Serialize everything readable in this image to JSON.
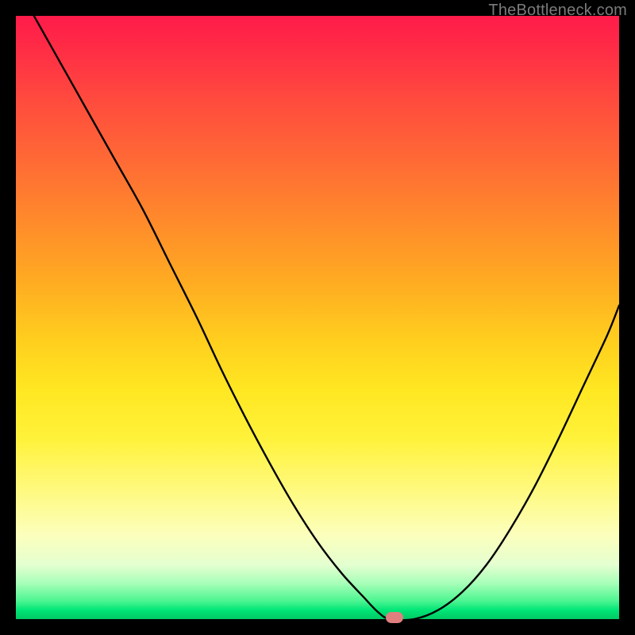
{
  "watermark": "TheBottleneck.com",
  "marker": {
    "x_frac": 0.628,
    "y_frac": 0.997
  },
  "colors": {
    "curve": "#000000",
    "marker": "#e17f7f",
    "frame": "#000000"
  },
  "chart_data": {
    "type": "line",
    "title": "",
    "xlabel": "",
    "ylabel": "",
    "xlim": [
      0,
      1
    ],
    "ylim": [
      0,
      1
    ],
    "annotations": [
      "TheBottleneck.com"
    ],
    "series": [
      {
        "name": "bottleneck-curve",
        "x": [
          0.03,
          0.075,
          0.12,
          0.165,
          0.21,
          0.255,
          0.3,
          0.34,
          0.38,
          0.42,
          0.46,
          0.5,
          0.54,
          0.575,
          0.6,
          0.62,
          0.66,
          0.7,
          0.74,
          0.78,
          0.82,
          0.86,
          0.9,
          0.94,
          0.98,
          1.0
        ],
        "y": [
          1.0,
          0.92,
          0.84,
          0.76,
          0.68,
          0.59,
          0.5,
          0.415,
          0.335,
          0.26,
          0.19,
          0.128,
          0.076,
          0.038,
          0.012,
          0.0,
          0.0,
          0.015,
          0.045,
          0.09,
          0.15,
          0.22,
          0.3,
          0.385,
          0.47,
          0.52
        ]
      }
    ],
    "marker": {
      "x": 0.628,
      "y": 0.003
    }
  }
}
